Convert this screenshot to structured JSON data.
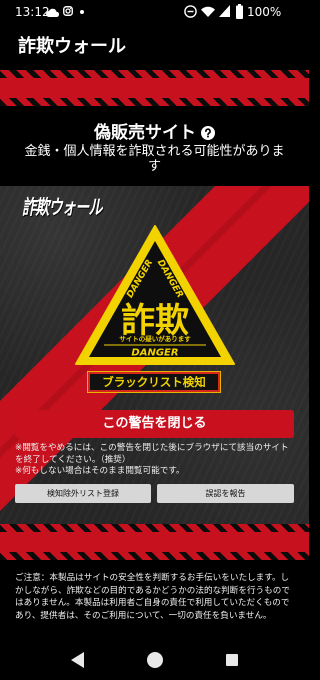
{
  "status_bar": {
    "time": "13:12",
    "battery_percent": "100%",
    "left_icons": [
      "cloud-icon",
      "instagram-icon",
      "notification-dot-icon"
    ],
    "right_icons": [
      "do-not-disturb-icon",
      "wifi-icon",
      "signal-icon",
      "battery-icon"
    ]
  },
  "app_bar": {
    "title": "詐欺ウォール"
  },
  "alert": {
    "heading": "偽販売サイト",
    "heading_icon": "help-icon",
    "description": "金銭・個人情報を詐取される可能性があります"
  },
  "panel": {
    "logo_text": "詐欺ウォール",
    "sign": {
      "main_text": "詐欺",
      "sub_text": "サイトの疑いがあります",
      "danger_label": "DANGER"
    },
    "detection_badge": "ブラックリスト検知",
    "close_button": "この警告を閉じる",
    "notes": [
      "※閲覧をやめるには、この警告を閉じた後にブラウザにて該当のサイトを終了してください。（推奨）",
      "※何もしない場合はそのまま閲覧可能です。"
    ],
    "exclude_button": "検知除外リスト登録",
    "report_button": "誤認を報告"
  },
  "disclaimer": "ご注意：本製品はサイトの安全性を判断するお手伝いをいたします。しかしながら、詐欺などの目的であるかどうかの法的な判断を行うものではありません。本製品は利用者ご自身の責任で利用していただくものであり、提供者は、そのご利用について、一切の責任を負いません。",
  "nav_bar": {
    "icons": [
      "back-icon",
      "home-icon",
      "recents-icon"
    ]
  },
  "colors": {
    "background": "#000000",
    "brand_red": "#c8111e",
    "warning_yellow": "#f2d300",
    "panel_gray": "#262626",
    "secondary_button": "#d7d7d7"
  }
}
